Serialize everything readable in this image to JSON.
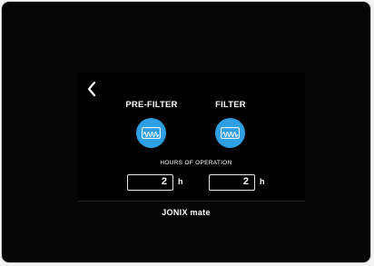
{
  "screen": {
    "prefilter_label": "PRE-FILTER",
    "filter_label": "FILTER",
    "hours_title": "HOURS OF OPERATION",
    "prefilter_hours": "2",
    "filter_hours": "2",
    "unit": "h"
  },
  "brand": "JONIX mate",
  "colors": {
    "accent": "#2e9fe3",
    "background": "#000000",
    "text": "#ffffff"
  },
  "icons": {
    "back": "chevron-left-icon",
    "filter": "wave-filter-icon"
  }
}
